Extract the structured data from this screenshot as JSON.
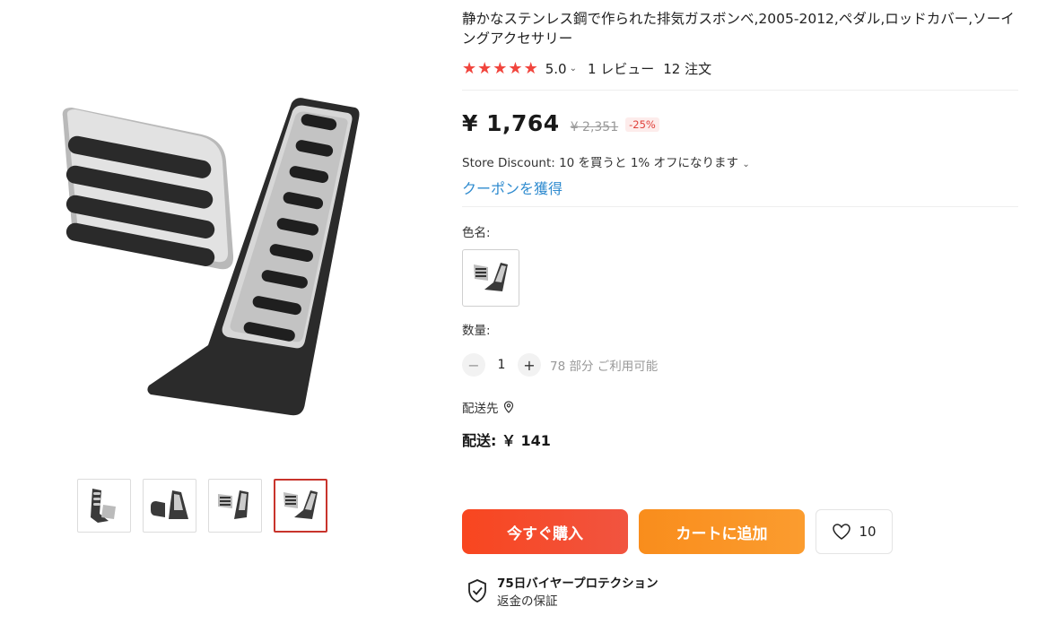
{
  "product": {
    "title": "静かなステンレス鋼で作られた排気ガスボンベ,2005-2012,ペダル,ロッドカバー,ソーイングアクセサリー",
    "rating": "5.0",
    "reviews": "1 レビュー",
    "orders": "12 注文",
    "stars": 5
  },
  "pricing": {
    "price": "¥ 1,764",
    "original_price": "¥ 2,351",
    "discount": "-25%",
    "store_discount": "Store Discount: 10 を買うと 1% オフになります",
    "coupon_link": "クーポンを獲得"
  },
  "variants": {
    "color_label": "色名:",
    "selected_color": "pedal-set"
  },
  "quantity": {
    "label": "数量:",
    "value": "1",
    "minus": "−",
    "plus": "+",
    "available": "78 部分 ご利用可能"
  },
  "shipping": {
    "to_label": "配送先",
    "cost": "配送: ￥ 141"
  },
  "actions": {
    "buy_now": "今すぐ購入",
    "add_to_cart": "カートに追加",
    "wishlist_count": "10"
  },
  "protection": {
    "title": "75日バイヤープロテクション",
    "subtitle": "返金の保証"
  },
  "gallery": {
    "thumbnails": [
      "pedal-angle-view",
      "pedal-side-view",
      "pedal-pair-view",
      "pedal-pair-top-view"
    ],
    "active_index": 3
  },
  "icons": {
    "star": "star-icon",
    "chevron": "chevron-down-icon",
    "location": "location-pin-icon",
    "heart": "heart-icon",
    "shield": "shield-check-icon"
  },
  "colors": {
    "accent_red": "#f1453d",
    "buy_button": "#f8461f",
    "cart_button": "#f98d1c",
    "link_blue": "#2f8bcf",
    "active_thumb_border": "#c8342c"
  }
}
